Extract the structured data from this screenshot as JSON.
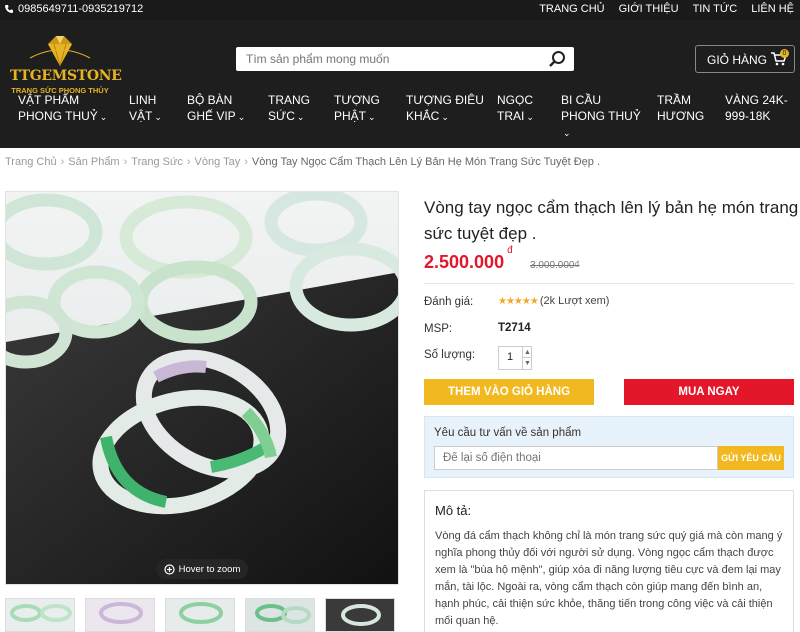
{
  "topbar": {
    "phone": "0985649711-0935219712",
    "links": [
      "TRANG CHỦ",
      "GIỚI THIỆU",
      "TIN TỨC",
      "LIÊN HỆ"
    ]
  },
  "header": {
    "logo_text": "TTGEMSTONE",
    "logo_tagline": "TRANG SỨC PHONG THỦY",
    "search_placeholder": "Tìm sản phẩm mong muốn",
    "cart_label": "GIỎ HÀNG",
    "cart_count": "0"
  },
  "nav": {
    "items": [
      {
        "line1": "VẬT PHẨM",
        "line2": "PHONG THUỶ"
      },
      {
        "line1": "LINH",
        "line2": "VẬT"
      },
      {
        "line1": "BỘ BÀN",
        "line2": "GHẾ VIP"
      },
      {
        "line1": "TRANG",
        "line2": "SỨC"
      },
      {
        "line1": "TƯỢNG",
        "line2": "PHẬT"
      },
      {
        "line1": "TƯỢNG ĐIÊU",
        "line2": "KHẮC"
      },
      {
        "line1": "NGỌC",
        "line2": "TRAI"
      },
      {
        "line1": "BI CẦU",
        "line2": "PHONG THUỶ"
      },
      {
        "line1": "TRẦM",
        "line2": "HƯƠNG"
      },
      {
        "line1": "VÀNG 24K-",
        "line2": "999-18K"
      }
    ]
  },
  "breadcrumb": [
    "Trang Chủ",
    "Sản Phẩm",
    "Trang Sức",
    "Vòng Tay",
    "Vòng Tay Ngọc Cẩm Thạch Lên Lý Bản Hẹ Món Trang Sức Tuyệt Đẹp ."
  ],
  "gallery": {
    "zoom_label": "Hover to zoom"
  },
  "product": {
    "title": "Vòng tay ngọc cẩm thạch lên lý bản hẹ món trang sức tuyệt đẹp .",
    "price": "2.500.000",
    "currency": "đ",
    "old_price": "3.000.000",
    "old_currency": "₫",
    "rating_label": "Đánh giá:",
    "rating_stars": 5,
    "rating_views": "(2k Lượt xem)",
    "sku_label": "MSP:",
    "sku": "T2714",
    "qty_label": "Số lượng:",
    "qty": "1",
    "add_to_cart": "THEM VÀO GIỎ HÀNG",
    "buy_now": "MUA NGAY"
  },
  "consult": {
    "label": "Yêu cầu tư vấn về sản phẩm",
    "placeholder": "Để lại số điện thoại",
    "submit": "GỬI YÊU CẦU"
  },
  "description": {
    "heading": "Mô tả:",
    "text": "Vòng đá cẩm thạch không chỉ là món trang sức quý giá mà còn mang ý nghĩa phong thủy đối với người sử dụng. Vòng ngọc cẩm thạch được xem là \"bùa hộ mệnh\", giúp xóa đi năng lượng tiêu cực và đem lại may mắn, tài lộc. Ngoài ra, vòng cẩm thạch còn giúp mang đến bình an, hạnh phúc, cải thiện sức khỏe, thăng tiến trong công việc và cải thiện mối quan hệ."
  },
  "colors": {
    "header_bg": "#1e1e1e",
    "gold": "#e6b422",
    "red": "#e3162a",
    "yellow_button": "#f2b81f"
  }
}
